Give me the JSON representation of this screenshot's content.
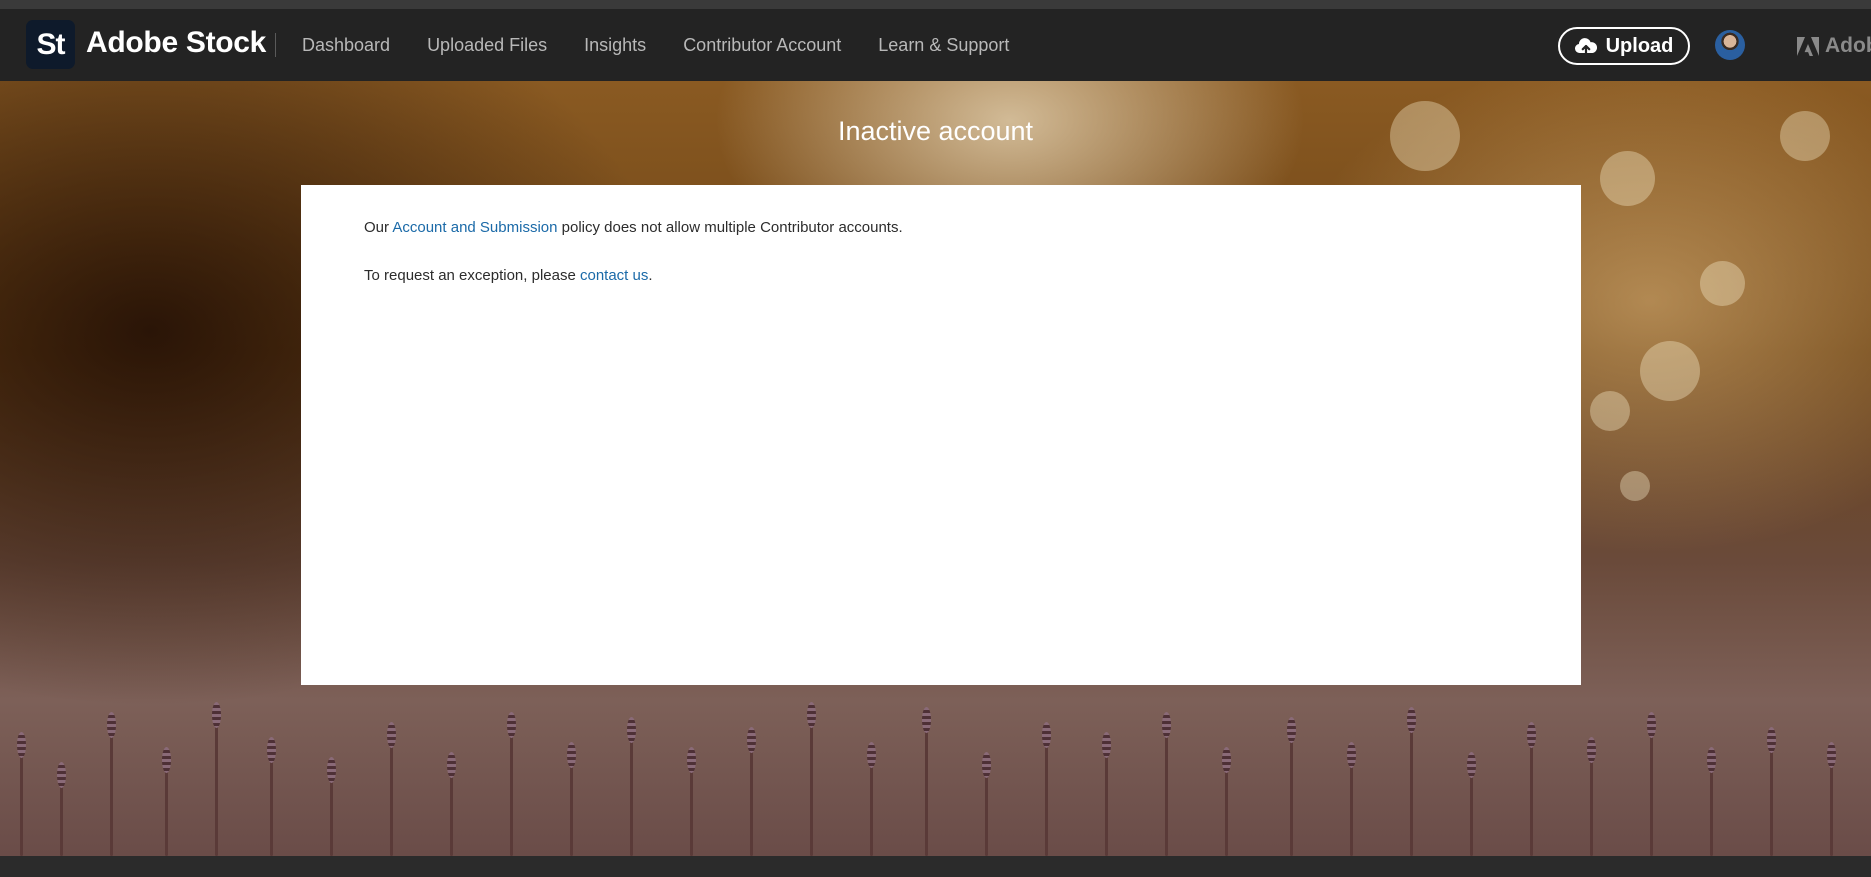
{
  "header": {
    "logo_text": "St",
    "brand": "Adobe Stock",
    "nav": [
      {
        "label": "Dashboard"
      },
      {
        "label": "Uploaded Files"
      },
      {
        "label": "Insights"
      },
      {
        "label": "Contributor Account"
      },
      {
        "label": "Learn & Support"
      }
    ],
    "upload_label": "Upload",
    "corner_brand": "Adob",
    "icons": {
      "upload": "cloud-upload-icon",
      "avatar": "user-avatar",
      "adobe": "adobe-logo-icon"
    }
  },
  "main": {
    "title": "Inactive account",
    "line1": {
      "before": "Our ",
      "link": "Account and Submission",
      "after": " policy does not allow multiple Contributor accounts."
    },
    "line2": {
      "before": "To request an exception, please ",
      "link": "contact us",
      "after": "."
    }
  },
  "colors": {
    "navbar": "#232323",
    "link": "#1b6aa8",
    "card": "#ffffff",
    "logo_tile": "#0e1a2b"
  }
}
